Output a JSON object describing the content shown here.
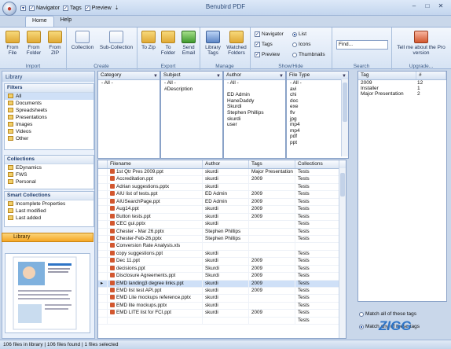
{
  "app": {
    "title": "Benubird PDF"
  },
  "qat": {
    "navigator": "Navigator",
    "tags": "Tags",
    "preview": "Preview"
  },
  "tabs": [
    "Home",
    "Help"
  ],
  "ribbon": {
    "import": {
      "label": "Import",
      "buttons": [
        "From File",
        "From Folder",
        "From ZIP"
      ]
    },
    "create": {
      "label": "Create",
      "buttons": [
        "Collection",
        "Sub-Collection"
      ]
    },
    "export": {
      "label": "Export",
      "buttons": [
        "To Zip",
        "To Folder",
        "Send Email"
      ]
    },
    "manage": {
      "label": "Manage",
      "buttons": [
        "Library Tags",
        "Watched Folders"
      ]
    },
    "showhide": {
      "label": "Show/Hide",
      "checks": [
        "Navigator",
        "Tags",
        "Preview"
      ],
      "views": [
        "List",
        "Icons",
        "Thumbnails"
      ]
    },
    "search": {
      "label": "Search",
      "placeholder": "Find..."
    },
    "upgrade": {
      "label": "Upgrade...",
      "button": "Tell me about the Pro version"
    }
  },
  "library_panel": {
    "title": "Library",
    "filters_title": "Filters",
    "filters": [
      "All",
      "Documents",
      "Spreadsheets",
      "Presentations",
      "Images",
      "Videos",
      "Other"
    ],
    "collections_title": "Collections",
    "collections": [
      "EDynamics",
      "FWS",
      "Personal"
    ],
    "smart_title": "Smart Collections",
    "smart": [
      "Incomplete Properties",
      "Last modified",
      "Last added"
    ],
    "band": "Library"
  },
  "filter_lists": {
    "category": {
      "header": "Category",
      "items": [
        "- All -"
      ]
    },
    "subject": {
      "header": "Subject",
      "items": [
        "- All -",
        "#Description"
      ]
    },
    "author": {
      "header": "Author",
      "items": [
        "- All -",
        "",
        "ED Admin",
        "HaneDaddy",
        "Skurdi",
        "Stephen Phillips",
        "skurdi",
        "user"
      ]
    },
    "filetype": {
      "header": "File Type",
      "items": [
        "- All -",
        "avi",
        "chi",
        "doc",
        "exe",
        "flv",
        "jpg",
        "mp4",
        "mp4",
        "pdf",
        "ppt"
      ]
    }
  },
  "tag_panel": {
    "headers": [
      "Tag",
      "#"
    ],
    "rows": [
      {
        "tag": "2009",
        "count": "12"
      },
      {
        "tag": "Installer",
        "count": "1"
      },
      {
        "tag": "Major Presentation",
        "count": "2"
      }
    ],
    "match_all": "Match all of these tags",
    "match_any": "Match any of these tags"
  },
  "file_table": {
    "headers": [
      "Filename",
      "Author",
      "Tags",
      "Collections"
    ],
    "rows": [
      [
        "1st Qtr Pres 2009.ppt",
        "skurdi",
        "Major Presentation",
        "Tests"
      ],
      [
        "Accreditation.ppt",
        "skurdi",
        "2009",
        "Tests"
      ],
      [
        "Adrian suggestions.pptx",
        "skurdi",
        "",
        "Tests"
      ],
      [
        "AIU list of tests.ppt",
        "ED Admin",
        "2009",
        "Tests"
      ],
      [
        "AIUSearchPage.ppt",
        "ED Admin",
        "2009",
        "Tests"
      ],
      [
        "Aug14.ppt",
        "skurdi",
        "2009",
        "Tests"
      ],
      [
        "Button tests.ppt",
        "skurdi",
        "2009",
        "Tests"
      ],
      [
        "CEC gui.pptx",
        "skurdi",
        "",
        "Tests"
      ],
      [
        "Chester - Mar 26.pptx",
        "Stephen Phillips",
        "",
        "Tests"
      ],
      [
        "Chester-Feb-26.pptx",
        "Stephen Phillips",
        "",
        "Tests"
      ],
      [
        "Conversion Rate Analysis.xls",
        "",
        "",
        ""
      ],
      [
        "copy suggestions.ppt",
        "skurdi",
        "",
        "Tests"
      ],
      [
        "Dec 11.ppt",
        "skurdi",
        "2009",
        "Tests"
      ],
      [
        "decisions.ppt",
        "Skurdi",
        "2009",
        "Tests"
      ],
      [
        "Disclosure Agreements.ppt",
        "Skurdi",
        "2009",
        "Tests"
      ],
      [
        "EMD landing3 degree links.ppt",
        "skurdi",
        "2009",
        "Tests"
      ],
      [
        "EMD list test API.ppt",
        "skurdi",
        "2009",
        "Tests"
      ],
      [
        "EMD Lite mockups reference.pptx",
        "skurdi",
        "",
        "Tests"
      ],
      [
        "EMD lite mockups.pptx",
        "skurdi",
        "",
        "Tests"
      ],
      [
        "EMD LITE list for FCI.ppt",
        "skurdi",
        "2009",
        "Tests"
      ],
      [
        "",
        "",
        "",
        "Tests"
      ]
    ]
  },
  "status": "106 files in library | 106 files found | 1 files selected",
  "watermark": "ZIGG"
}
